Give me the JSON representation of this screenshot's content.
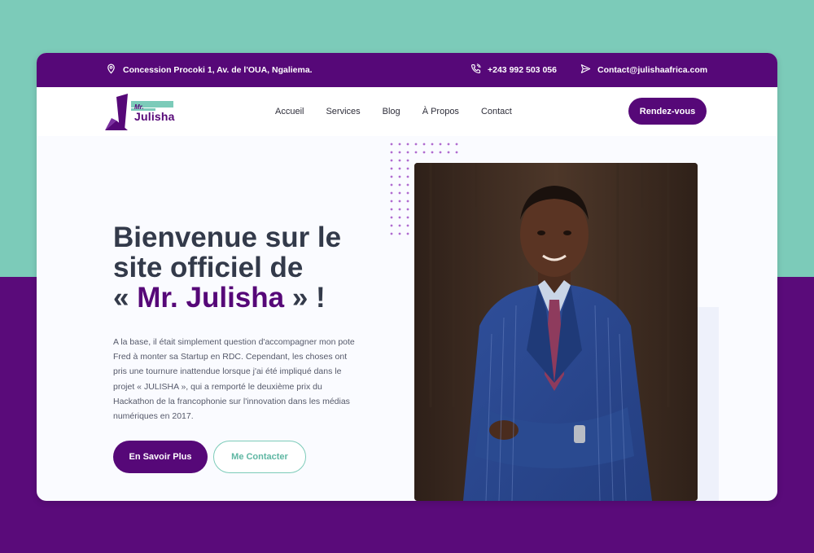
{
  "topbar": {
    "address": "Concession Procoki 1, Av. de l'OUA, Ngaliema.",
    "phone": "+243 992 503 056",
    "email": "Contact@julishaafrica.com",
    "address_icon": "location-pin-icon",
    "phone_icon": "phone-icon",
    "email_icon": "send-icon"
  },
  "logo": {
    "mr": "Mr.",
    "name": "Julisha"
  },
  "nav": {
    "items": [
      "Accueil",
      "Services",
      "Blog",
      "À Propos",
      "Contact"
    ],
    "cta": "Rendez-vous"
  },
  "hero": {
    "title_line1": "Bienvenue sur le",
    "title_line2": "site officiel de",
    "title_open": "« ",
    "title_highlight": "Mr. Julisha",
    "title_close": " » !",
    "text": "A la base, il était simplement question d'accompagner mon pote Fred à monter sa Startup en RDC. Cependant, les choses ont pris une tournure inattendue lorsque j'ai été impliqué dans le projet « JULISHA », qui a remporté le deuxième prix du Hackathon de la francophonie sur l'innovation dans les médias numériques en 2017.",
    "btn_primary": "En Savoir Plus",
    "btn_secondary": "Me Contacter"
  },
  "colors": {
    "brand_purple": "#560878",
    "accent_teal": "#7ccbb9"
  }
}
